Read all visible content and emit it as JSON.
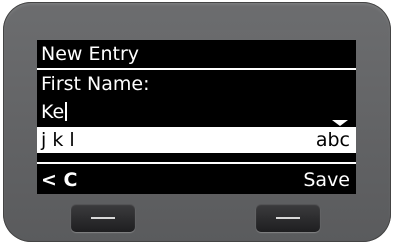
{
  "screen": {
    "title": "New Entry",
    "field_label": "First Name:",
    "field_value": "Ke",
    "input_chars": "j k l",
    "input_mode": "abc"
  },
  "softkeys": {
    "left_label": "< C",
    "right_label": "Save"
  },
  "icons": {
    "down_arrow": "triangle-down",
    "cursor": "text-caret"
  }
}
